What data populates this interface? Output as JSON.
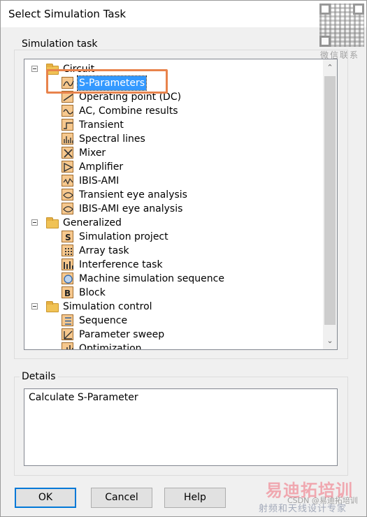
{
  "window": {
    "title": "Select Simulation Task"
  },
  "groups": {
    "simulation_task": "Simulation task",
    "details": "Details"
  },
  "tree": {
    "categories": [
      {
        "label": "Circuit",
        "items": [
          {
            "label": "S-Parameters",
            "icon": "sparam-icon",
            "selected": true
          },
          {
            "label": "Operating point (DC)",
            "icon": "dc-icon"
          },
          {
            "label": "AC, Combine results",
            "icon": "ac-icon"
          },
          {
            "label": "Transient",
            "icon": "transient-icon"
          },
          {
            "label": "Spectral lines",
            "icon": "spectral-icon"
          },
          {
            "label": "Mixer",
            "icon": "mixer-icon"
          },
          {
            "label": "Amplifier",
            "icon": "amplifier-icon"
          },
          {
            "label": "IBIS-AMI",
            "icon": "ibis-icon"
          },
          {
            "label": "Transient eye analysis",
            "icon": "eye-icon"
          },
          {
            "label": "IBIS-AMI eye analysis",
            "icon": "eye-icon"
          }
        ]
      },
      {
        "label": "Generalized",
        "items": [
          {
            "label": "Simulation project",
            "icon": "project-icon"
          },
          {
            "label": "Array task",
            "icon": "array-icon"
          },
          {
            "label": "Interference task",
            "icon": "interference-icon"
          },
          {
            "label": "Machine simulation sequence",
            "icon": "machine-icon"
          },
          {
            "label": "Block",
            "icon": "block-icon"
          }
        ]
      },
      {
        "label": "Simulation control",
        "items": [
          {
            "label": "Sequence",
            "icon": "sequence-icon"
          },
          {
            "label": "Parameter sweep",
            "icon": "sweep-icon"
          },
          {
            "label": "Optimization",
            "icon": "optimization-icon"
          }
        ]
      }
    ]
  },
  "details": {
    "text": "Calculate S-Parameter"
  },
  "buttons": {
    "ok": "OK",
    "cancel": "Cancel",
    "help": "Help"
  },
  "watermark": {
    "qr_caption": "微信联系",
    "brand": "易迪拓培训",
    "brand_sub": "射频和天线设计专家",
    "csdn": "CSDN @易迪拓培训"
  },
  "colors": {
    "selection": "#3399ff",
    "highlight": "#e8834c",
    "default_button_border": "#0078d7"
  }
}
